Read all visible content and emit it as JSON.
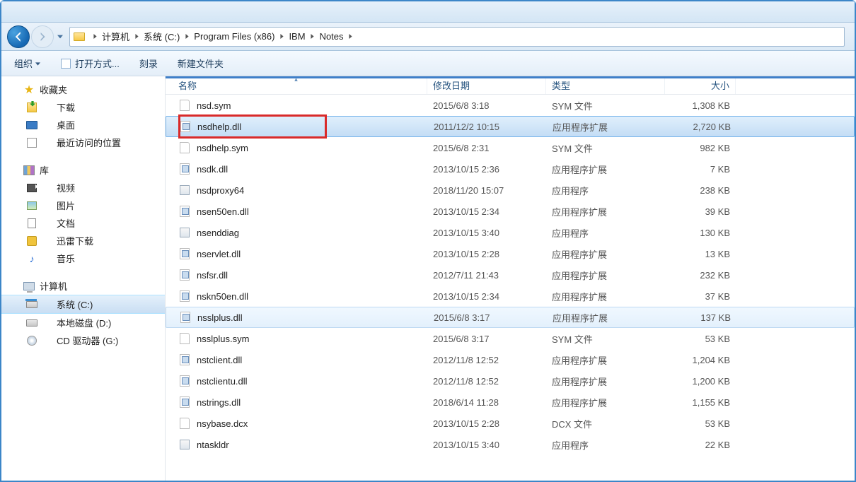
{
  "nav": {
    "back": "Back",
    "forward": "Forward"
  },
  "breadcrumb": [
    {
      "label": "计算机"
    },
    {
      "label": "系统 (C:)"
    },
    {
      "label": "Program Files (x86)"
    },
    {
      "label": "IBM"
    },
    {
      "label": "Notes"
    }
  ],
  "toolbar": {
    "organize": "组织",
    "openWith": "打开方式...",
    "burn": "刻录",
    "newFolder": "新建文件夹"
  },
  "sidebar": {
    "favorites": {
      "header": "收藏夹",
      "items": [
        {
          "label": "下载",
          "icon": "download"
        },
        {
          "label": "桌面",
          "icon": "desktop"
        },
        {
          "label": "最近访问的位置",
          "icon": "recent"
        }
      ]
    },
    "libraries": {
      "header": "库",
      "items": [
        {
          "label": "视频",
          "icon": "video"
        },
        {
          "label": "图片",
          "icon": "pic"
        },
        {
          "label": "文档",
          "icon": "doc"
        },
        {
          "label": "迅雷下载",
          "icon": "thunder"
        },
        {
          "label": "音乐",
          "icon": "music"
        }
      ]
    },
    "computer": {
      "header": "计算机",
      "items": [
        {
          "label": "系统 (C:)",
          "icon": "drive-c",
          "selected": true
        },
        {
          "label": "本地磁盘 (D:)",
          "icon": "drive"
        },
        {
          "label": "CD 驱动器 (G:)",
          "icon": "cd"
        }
      ]
    }
  },
  "columns": {
    "name": "名称",
    "date": "修改日期",
    "type": "类型",
    "size": "大小"
  },
  "files": [
    {
      "name": "nsd.sym",
      "date": "2015/6/8 3:18",
      "type": "SYM 文件",
      "size": "1,308 KB",
      "icon": "blank"
    },
    {
      "name": "nsdhelp.dll",
      "date": "2011/12/2 10:15",
      "type": "应用程序扩展",
      "size": "2,720 KB",
      "icon": "dll",
      "selected": true,
      "highlighted": true
    },
    {
      "name": "nsdhelp.sym",
      "date": "2015/6/8 2:31",
      "type": "SYM 文件",
      "size": "982 KB",
      "icon": "blank"
    },
    {
      "name": "nsdk.dll",
      "date": "2013/10/15 2:36",
      "type": "应用程序扩展",
      "size": "7 KB",
      "icon": "dll"
    },
    {
      "name": "nsdproxy64",
      "date": "2018/11/20 15:07",
      "type": "应用程序",
      "size": "238 KB",
      "icon": "exe"
    },
    {
      "name": "nsen50en.dll",
      "date": "2013/10/15 2:34",
      "type": "应用程序扩展",
      "size": "39 KB",
      "icon": "dll"
    },
    {
      "name": "nsenddiag",
      "date": "2013/10/15 3:40",
      "type": "应用程序",
      "size": "130 KB",
      "icon": "exe"
    },
    {
      "name": "nservlet.dll",
      "date": "2013/10/15 2:28",
      "type": "应用程序扩展",
      "size": "13 KB",
      "icon": "dll"
    },
    {
      "name": "nsfsr.dll",
      "date": "2012/7/11 21:43",
      "type": "应用程序扩展",
      "size": "232 KB",
      "icon": "dll"
    },
    {
      "name": "nskn50en.dll",
      "date": "2013/10/15 2:34",
      "type": "应用程序扩展",
      "size": "37 KB",
      "icon": "dll"
    },
    {
      "name": "nsslplus.dll",
      "date": "2015/6/8 3:17",
      "type": "应用程序扩展",
      "size": "137 KB",
      "icon": "dll",
      "hover": true
    },
    {
      "name": "nsslplus.sym",
      "date": "2015/6/8 3:17",
      "type": "SYM 文件",
      "size": "53 KB",
      "icon": "blank"
    },
    {
      "name": "nstclient.dll",
      "date": "2012/11/8 12:52",
      "type": "应用程序扩展",
      "size": "1,204 KB",
      "icon": "dll"
    },
    {
      "name": "nstclientu.dll",
      "date": "2012/11/8 12:52",
      "type": "应用程序扩展",
      "size": "1,200 KB",
      "icon": "dll"
    },
    {
      "name": "nstrings.dll",
      "date": "2018/6/14 11:28",
      "type": "应用程序扩展",
      "size": "1,155 KB",
      "icon": "dll"
    },
    {
      "name": "nsybase.dcx",
      "date": "2013/10/15 2:28",
      "type": "DCX 文件",
      "size": "53 KB",
      "icon": "blank"
    },
    {
      "name": "ntaskldr",
      "date": "2013/10/15 3:40",
      "type": "应用程序",
      "size": "22 KB",
      "icon": "exe"
    }
  ]
}
